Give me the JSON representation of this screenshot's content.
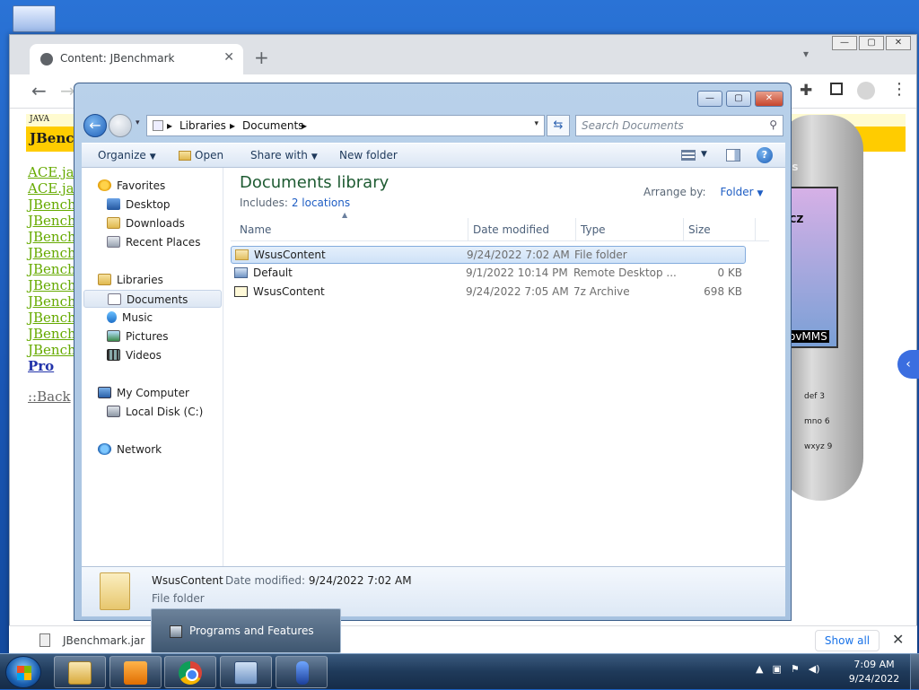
{
  "browser": {
    "tab_title": "Content: JBenchmark",
    "tab_close": "✕",
    "new_tab": "+",
    "page": {
      "java_small": "JAVA",
      "java_title": "JBench",
      "links": [
        "ACE.jac",
        "ACE.jar",
        "JBenchn",
        "JBenchn",
        "JBenchn",
        "JBenchn",
        "JBenchn",
        "JBenchn",
        "JBenchn",
        "JBenchn",
        "JBenchn",
        "JBenchn"
      ],
      "pro_link": "Pro",
      "back_link": "::Back",
      "phone_brand": "NS",
      "phone_label_top": "e CZ",
      "phone_label_bottom": "NovMMS",
      "phone_keys": [
        "def 3",
        "mno 6",
        "wxyz 9"
      ]
    },
    "download": {
      "file_name": "JBenchmark.jar",
      "show_all": "Show all",
      "close": "✕"
    }
  },
  "explorer": {
    "breadcrumb": [
      "Libraries",
      "Documents"
    ],
    "search_placeholder": "Search Documents",
    "toolbar": {
      "organize": "Organize",
      "open": "Open",
      "share_with": "Share with",
      "new_folder": "New folder"
    },
    "nav": {
      "favorites": "Favorites",
      "desktop": "Desktop",
      "downloads": "Downloads",
      "recent_places": "Recent Places",
      "libraries": "Libraries",
      "documents": "Documents",
      "music": "Music",
      "pictures": "Pictures",
      "videos": "Videos",
      "my_computer": "My Computer",
      "local_disk": "Local Disk (C:)",
      "network": "Network"
    },
    "library": {
      "title": "Documents library",
      "includes_label": "Includes:",
      "includes_link": "2 locations",
      "arrange_by_label": "Arrange by:",
      "arrange_by_value": "Folder"
    },
    "columns": {
      "name": "Name",
      "date": "Date modified",
      "type": "Type",
      "size": "Size"
    },
    "files": [
      {
        "name": "WsusContent",
        "date": "9/24/2022 7:02 AM",
        "type": "File folder",
        "size": ""
      },
      {
        "name": "Default",
        "date": "9/1/2022 10:14 PM",
        "type": "Remote Desktop ...",
        "size": "0 KB"
      },
      {
        "name": "WsusContent",
        "date": "9/24/2022 7:05 AM",
        "type": "7z Archive",
        "size": "698 KB"
      }
    ],
    "details": {
      "name": "WsusContent",
      "modified_label": "Date modified:",
      "modified_value": "9/24/2022 7:02 AM",
      "type": "File folder"
    }
  },
  "taskbar": {
    "tooltip": "Programs and Features",
    "clock_time": "7:09 AM",
    "clock_date": "9/24/2022"
  }
}
